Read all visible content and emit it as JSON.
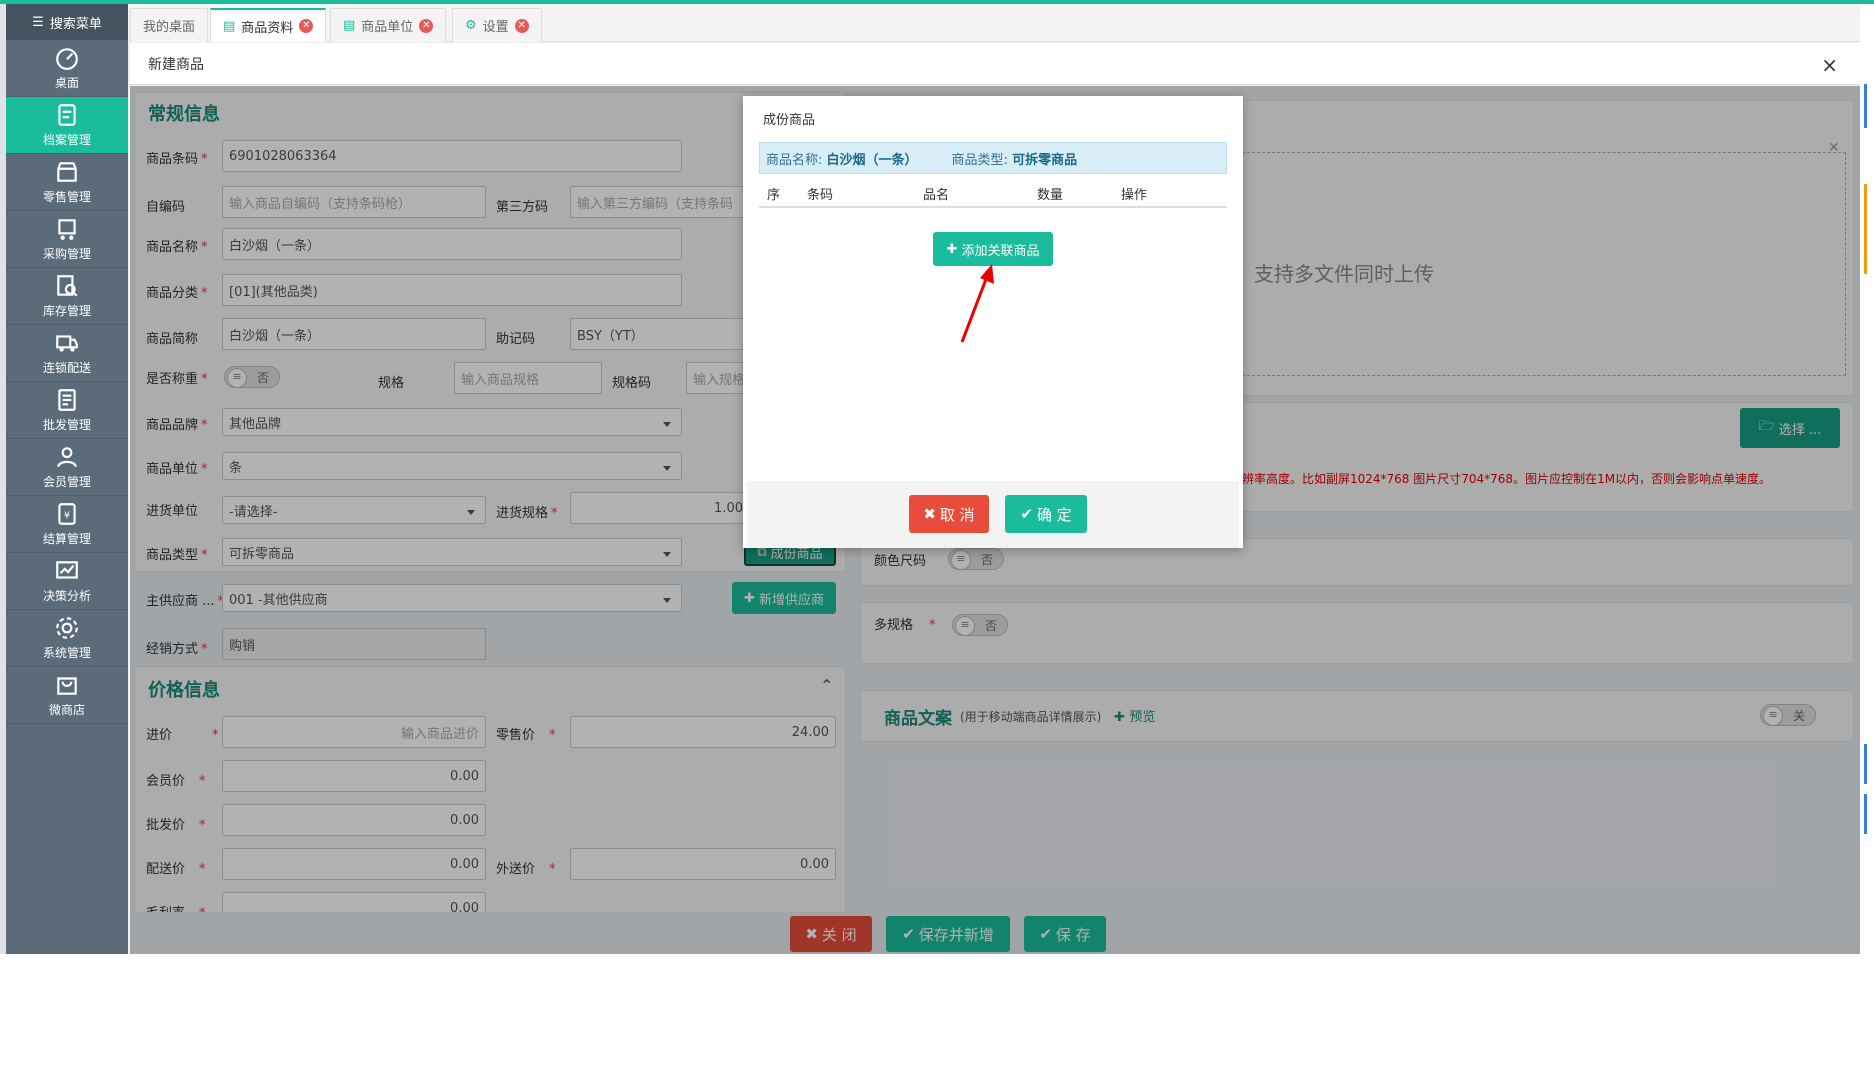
{
  "sidebar": {
    "search_label": "搜索菜单",
    "items": [
      {
        "label": "桌面",
        "icon": "dashboard-icon"
      },
      {
        "label": "档案管理",
        "icon": "archive-icon"
      },
      {
        "label": "零售管理",
        "icon": "store-icon"
      },
      {
        "label": "采购管理",
        "icon": "purchase-icon"
      },
      {
        "label": "库存管理",
        "icon": "inventory-icon"
      },
      {
        "label": "连锁配送",
        "icon": "delivery-icon"
      },
      {
        "label": "批发管理",
        "icon": "wholesale-icon"
      },
      {
        "label": "会员管理",
        "icon": "member-icon"
      },
      {
        "label": "结算管理",
        "icon": "settlement-icon"
      },
      {
        "label": "决策分析",
        "icon": "analysis-icon"
      },
      {
        "label": "系统管理",
        "icon": "system-icon"
      },
      {
        "label": "微商店",
        "icon": "microshop-icon"
      }
    ]
  },
  "tabs": [
    {
      "label": "我的桌面"
    },
    {
      "label": "商品资料"
    },
    {
      "label": "商品单位"
    },
    {
      "label": "设置"
    }
  ],
  "panel": {
    "title": "新建商品",
    "close": "×"
  },
  "general": {
    "title": "常规信息",
    "barcode_label": "商品条码",
    "barcode_value": "6901028063364",
    "selfcode_label": "自编码",
    "selfcode_placeholder": "输入商品自编码（支持条码枪）",
    "thirdcode_label": "第三方码",
    "thirdcode_placeholder": "输入第三方编码（支持条码",
    "name_label": "商品名称",
    "name_value": "白沙烟（一条）",
    "category_label": "商品分类",
    "category_value": "[01](其他品类)",
    "short_label": "商品简称",
    "short_value": "白沙烟（一条）",
    "mnemonic_label": "助记码",
    "mnemonic_value": "BSY（YT）",
    "weigh_label": "是否称重",
    "weigh_value": "否",
    "spec_label": "规格",
    "spec_placeholder": "输入商品规格",
    "speccode_label": "规格码",
    "speccode_placeholder": "输入规格",
    "brand_label": "商品品牌",
    "brand_value": "其他品牌",
    "unit_label": "商品单位",
    "unit_value": "条",
    "purchase_unit_label": "进货单位",
    "purchase_unit_value": "-请选择-",
    "purchase_spec_label": "进货规格",
    "purchase_spec_value": "1.00",
    "type_label": "商品类型",
    "type_value": "可拆零商品",
    "component_button": "成份商品",
    "supplier_label": "主供应商 ...",
    "supplier_value": "001 -其他供应商",
    "add_supplier_button": "新增供应商",
    "sale_mode_label": "经销方式",
    "sale_mode_value": "购销"
  },
  "price": {
    "title": "价格信息",
    "purchase_label": "进价",
    "purchase_placeholder": "输入商品进价",
    "retail_label": "零售价",
    "retail_value": "24.00",
    "member_label": "会员价",
    "member_value": "0.00",
    "wholesale_label": "批发价",
    "wholesale_value": "0.00",
    "delivery_label": "配送价",
    "delivery_value": "0.00",
    "external_label": "外送价",
    "external_value": "0.00",
    "partial_label": "毛利率",
    "partial_value": "0.00"
  },
  "right": {
    "upload_text": "支持多文件同时上传",
    "choose_button": "选择 ...",
    "image_hint": "辨率高度。比如副屏1024*768 图片尺寸704*768。图片应控制在1M以内，否则会影响点单速度。",
    "color_size_label": "颜色尺码",
    "color_size_value": "否",
    "multi_spec_label": "多规格",
    "multi_spec_value": "否",
    "copy_title": "商品文案",
    "copy_sub": "(用于移动端商品详情展示)",
    "preview": "预览",
    "copy_toggle": "关"
  },
  "footer": {
    "close": "关 闭",
    "save_new": "保存并新增",
    "save": "保 存"
  },
  "modal": {
    "title": "成份商品",
    "info_name_label": "商品名称:",
    "info_name_value": "白沙烟（一条）",
    "info_type_label": "商品类型:",
    "info_type_value": "可拆零商品",
    "columns": [
      "序",
      "条码",
      "品名",
      "数量",
      "操作"
    ],
    "add_button": "添加关联商品",
    "cancel": "取 消",
    "confirm": "确 定"
  },
  "colors": {
    "accent": "#1abc9c",
    "danger": "#e74c3c",
    "sidebar": "#5b6b79"
  }
}
